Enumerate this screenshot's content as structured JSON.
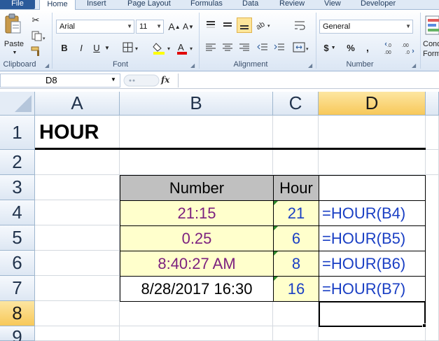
{
  "ribbon": {
    "tabs": [
      "File",
      "Home",
      "Insert",
      "Page Layout",
      "Formulas",
      "Data",
      "Review",
      "View",
      "Developer"
    ],
    "clipboard": {
      "paste_label": "Paste",
      "group_label": "Clipboard"
    },
    "font": {
      "font_name": "Arial",
      "font_size": "11",
      "bold": "B",
      "italic": "I",
      "underline": "U",
      "grow": "A",
      "shrink": "A",
      "group_label": "Font"
    },
    "alignment": {
      "group_label": "Alignment"
    },
    "number": {
      "format": "General",
      "currency": "$",
      "percent": "%",
      "comma": ",",
      "inc_dec": ".0→.00",
      "dec_dec": ".00→.0",
      "group_label": "Number"
    },
    "styles": {
      "cond_label_1": "Cond",
      "cond_label_2": "Form"
    }
  },
  "formula_bar": {
    "name_box": "D8",
    "fx": "fx",
    "content": ""
  },
  "columns": [
    "A",
    "B",
    "C",
    "D"
  ],
  "selected_column": "D",
  "rows": [
    "1",
    "2",
    "3",
    "4",
    "5",
    "6",
    "7",
    "8",
    "9"
  ],
  "selected_row": "8",
  "sheet": {
    "title": "HOUR",
    "headers": {
      "number": "Number",
      "hour": "Hour"
    },
    "data_rows": [
      {
        "number": "21:15",
        "hour": "21",
        "formula": "=HOUR(B4)"
      },
      {
        "number": "0.25",
        "hour": "6",
        "formula": "=HOUR(B5)"
      },
      {
        "number": "8:40:27 AM",
        "hour": "8",
        "formula": "=HOUR(B6)"
      },
      {
        "number": "8/28/2017 16:30",
        "hour": "16",
        "formula": "=HOUR(B7)"
      }
    ]
  },
  "colors": {
    "number_text": "#7b1f7e",
    "formula_text": "#1a3fc4",
    "input_fill": "#ffffcc",
    "header_fill": "#c0c0c0",
    "selected_header": "#f7c859"
  }
}
